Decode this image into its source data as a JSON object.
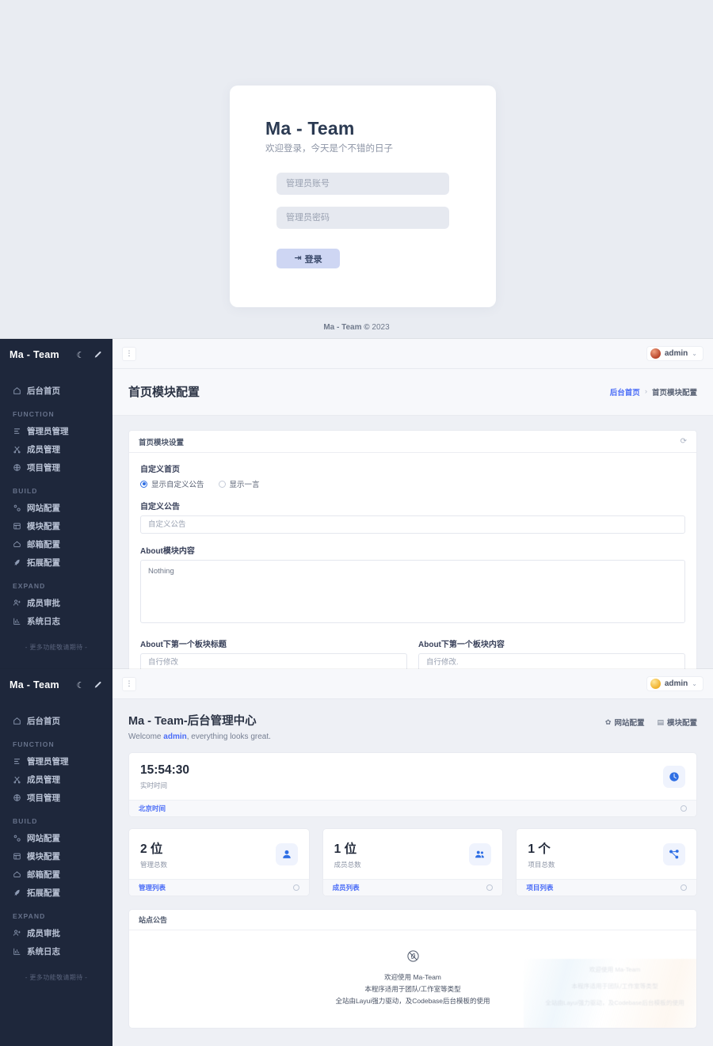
{
  "login": {
    "title": "Ma - Team",
    "subtitle": "欢迎登录，今天是个不错的日子",
    "username_placeholder": "管理员账号",
    "password_placeholder": "管理员密码",
    "submit_label": "登录",
    "submit_icon": "login-arrow-icon",
    "footer_brand": "Ma - Team ©",
    "footer_year": "2023"
  },
  "sidebar": {
    "brand": "Ma - Team",
    "dark_mode_icon": "moon-icon",
    "theme_icon": "pen-icon",
    "home": {
      "label": "后台首页",
      "icon": "home-icon"
    },
    "groups": [
      {
        "title": "FUNCTION",
        "items": [
          {
            "label": "管理员管理",
            "icon": "list-icon"
          },
          {
            "label": "成员管理",
            "icon": "scissors-icon"
          },
          {
            "label": "项目管理",
            "icon": "globe-icon"
          }
        ]
      },
      {
        "title": "BUILD",
        "items": [
          {
            "label": "网站配置",
            "icon": "gear-dot-icon"
          },
          {
            "label": "模块配置",
            "icon": "grid-icon"
          },
          {
            "label": "邮箱配置",
            "icon": "mail-icon"
          },
          {
            "label": "拓展配置",
            "icon": "rocket-icon"
          }
        ]
      },
      {
        "title": "EXPAND",
        "items": [
          {
            "label": "成员审批",
            "icon": "user-plus-icon"
          },
          {
            "label": "系统日志",
            "icon": "chart-icon"
          }
        ]
      }
    ],
    "footer": "- 更多功能敬请期待 -"
  },
  "topbar": {
    "more_icon": "vertical-dots-icon",
    "user_name": "admin",
    "avatar_icon": "avatar",
    "chevron_icon": "chevron-down-icon"
  },
  "module_page": {
    "title": "首页模块配置",
    "breadcrumb_home": "后台首页",
    "breadcrumb_sep": "›",
    "breadcrumb_current": "首页模块配置",
    "card_title": "首页模块设置",
    "refresh_icon": "refresh-icon",
    "custom_home_label": "自定义首页",
    "radio_custom": "显示自定义公告",
    "radio_hitokoto": "显示一言",
    "radio_selected": "显示自定义公告",
    "notice_label": "自定义公告",
    "notice_placeholder": "自定义公告",
    "about_label": "About模块内容",
    "about_value": "Nothing",
    "block1_title_label": "About下第一个板块标题",
    "block1_title_placeholder": "自行修改",
    "block1_body_label": "About下第一个板块内容",
    "block1_body_placeholder": "自行修改."
  },
  "dashboard": {
    "title": "Ma - Team-后台管理中心",
    "welcome_prefix": "Welcome ",
    "welcome_user": "admin",
    "welcome_suffix": ", everything looks great.",
    "quick_links": [
      {
        "label": "网站配置",
        "icon": "gear-icon"
      },
      {
        "label": "模块配置",
        "icon": "grid-icon"
      }
    ],
    "clock": {
      "value": "15:54:30",
      "label": "实时时间",
      "footer_link": "北京时间",
      "icon": "clock-icon"
    },
    "stats": [
      {
        "value": "2 位",
        "label": "管理总数",
        "link": "管理列表",
        "icon": "user-icon"
      },
      {
        "value": "1 位",
        "label": "成员总数",
        "link": "成员列表",
        "icon": "users-icon"
      },
      {
        "value": "1 个",
        "label": "项目总数",
        "link": "项目列表",
        "icon": "sitemap-icon"
      }
    ],
    "notice": {
      "card_title": "站点公告",
      "icon": "no-link-icon",
      "lines": [
        "欢迎使用 Ma-Team",
        "本程序适用于团队/工作室等类型",
        "全站由Layui强力驱动，及Codebase后台模板的使用"
      ]
    }
  },
  "colors": {
    "accent": "#4a6cf7",
    "sidebar_bg": "#1e273b",
    "page_bg": "#eef0f5",
    "login_bg": "#e9ecf2"
  }
}
